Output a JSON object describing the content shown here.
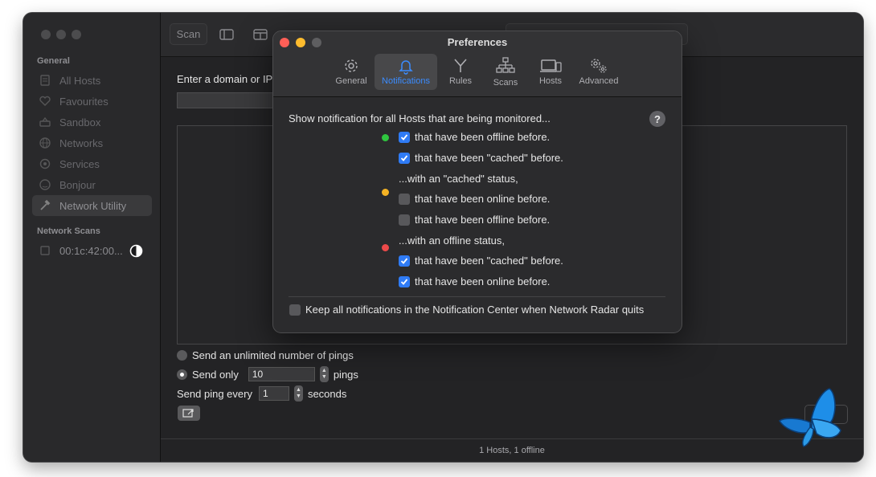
{
  "sidebar": {
    "section_general": "General",
    "items": [
      {
        "label": "All Hosts",
        "icon": "hosts-icon"
      },
      {
        "label": "Favourites",
        "icon": "heart-icon"
      },
      {
        "label": "Sandbox",
        "icon": "sandbox-icon"
      },
      {
        "label": "Networks",
        "icon": "globe-icon"
      },
      {
        "label": "Services",
        "icon": "services-icon"
      },
      {
        "label": "Bonjour",
        "icon": "bonjour-icon"
      },
      {
        "label": "Network Utility",
        "icon": "hammer-icon",
        "active": true
      }
    ],
    "section_scans": "Network Scans",
    "scan_item": {
      "label": "00:1c:42:00...",
      "icon": "half-circle-icon"
    }
  },
  "toolbar": {
    "scan_label": "Scan"
  },
  "main": {
    "prompt_label": "Enter a domain or IP",
    "option_unlimited": "Send an unlimited number of pings",
    "option_send_only": "Send only",
    "send_only_value": "10",
    "pings_label": "pings",
    "send_every_label": "Send ping every",
    "send_every_value": "1",
    "seconds_label": "seconds"
  },
  "status_bar": {
    "text": "1 Hosts, 1 offline"
  },
  "preferences": {
    "title": "Preferences",
    "tabs": [
      {
        "label": "General",
        "icon": "gear-icon"
      },
      {
        "label": "Notifications",
        "icon": "bell-icon",
        "active": true
      },
      {
        "label": "Rules",
        "icon": "rules-icon"
      },
      {
        "label": "Scans",
        "icon": "scans-icon"
      },
      {
        "label": "Hosts",
        "icon": "hosts-devices-icon"
      },
      {
        "label": "Advanced",
        "icon": "gears-icon"
      }
    ],
    "heading": "Show notification for all Hosts that are being monitored...",
    "help": "?",
    "group_online": {
      "status_color": "#2fc53f",
      "options": [
        {
          "label": "that have been offline before.",
          "checked": true
        },
        {
          "label": "that have been \"cached\" before.",
          "checked": true
        }
      ]
    },
    "group_cached": {
      "label": "...with an \"cached\" status,",
      "status_color": "#f5b324",
      "options": [
        {
          "label": "that have been online before.",
          "checked": false
        },
        {
          "label": "that have been offline before.",
          "checked": false
        }
      ]
    },
    "group_offline": {
      "label": "...with an offline status,",
      "status_color": "#ec4a4a",
      "options": [
        {
          "label": "that have been \"cached\" before.",
          "checked": true
        },
        {
          "label": "that have been online before.",
          "checked": true
        }
      ]
    },
    "keep_notifications": {
      "label": "Keep all notifications in the Notification Center when Network Radar quits",
      "checked": false
    }
  },
  "colors": {
    "accent": "#2f7bf5",
    "close": "#ff5f57",
    "minimize": "#febc2e",
    "zoom_disabled": "#5e5e60"
  }
}
